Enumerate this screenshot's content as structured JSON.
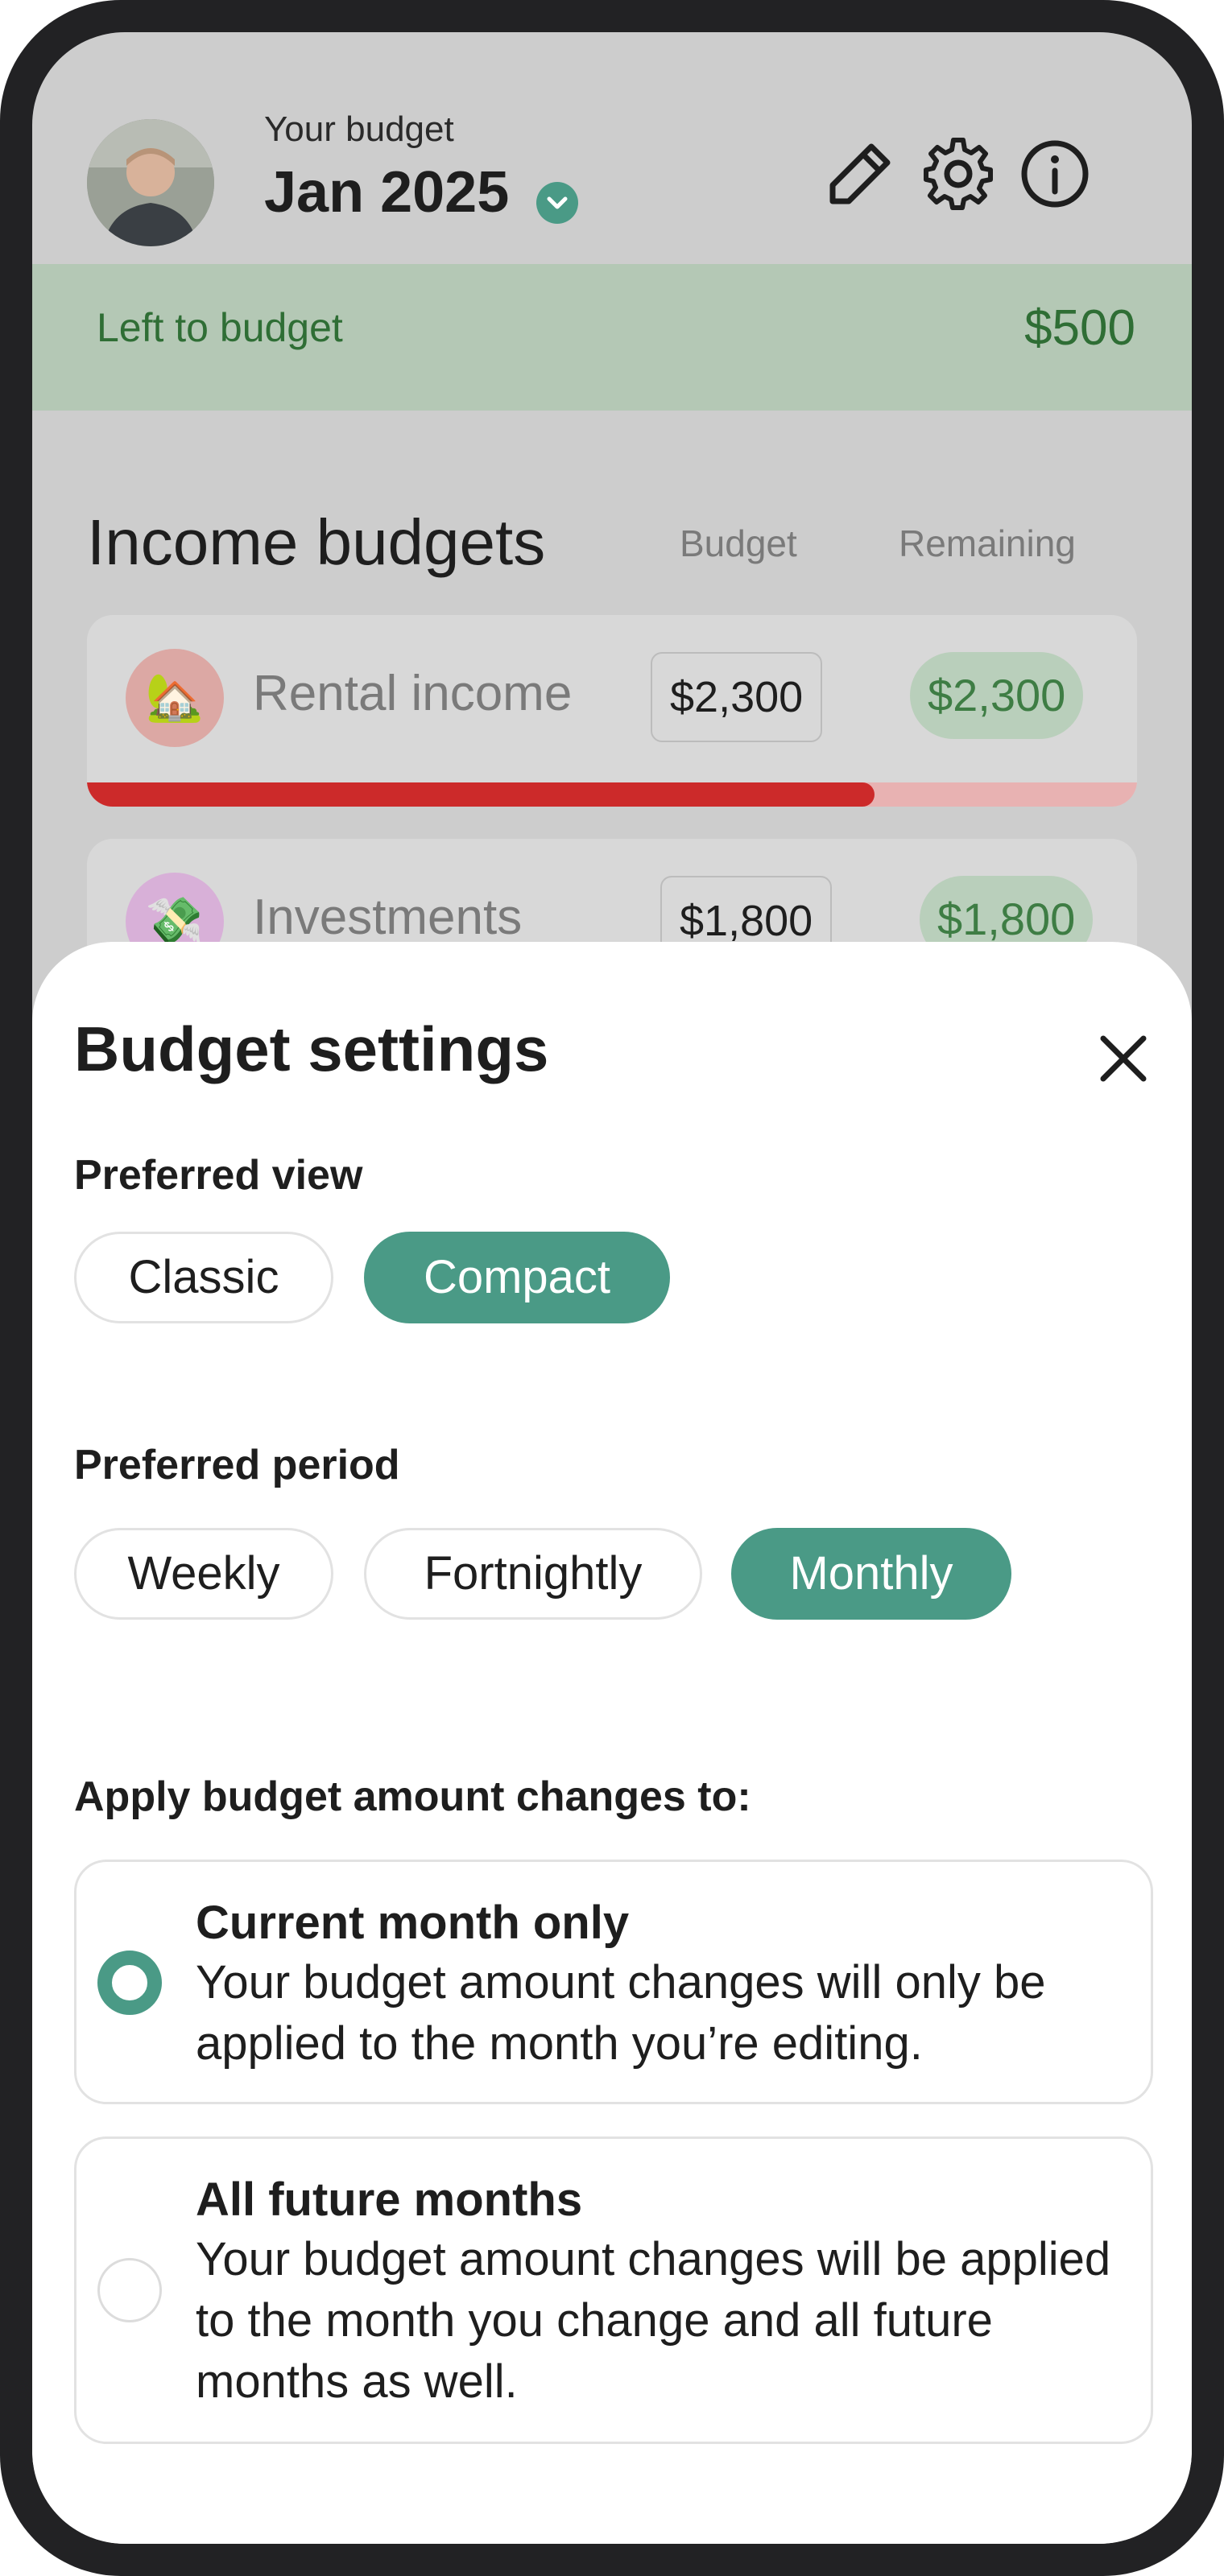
{
  "header": {
    "subtitle": "Your budget",
    "month": "Jan 2025",
    "icons": [
      "pencil-icon",
      "gear-icon",
      "info-icon",
      "chevron-down-icon"
    ]
  },
  "left_to_budget": {
    "label": "Left to budget",
    "value": "$500"
  },
  "income": {
    "title": "Income budgets",
    "col_budget": "Budget",
    "col_remaining": "Remaining",
    "items": [
      {
        "icon": "🏡",
        "name": "Rental income",
        "budget": "$2,300",
        "remaining": "$2,300",
        "progress": 0.75
      },
      {
        "icon": "💸",
        "name": "Investments",
        "budget": "$1,800",
        "remaining": "$1,800"
      }
    ]
  },
  "settings": {
    "title": "Budget settings",
    "view_label": "Preferred view",
    "views": [
      "Classic",
      "Compact"
    ],
    "view_selected": "Compact",
    "period_label": "Preferred period",
    "periods": [
      "Weekly",
      "Fortnightly",
      "Monthly"
    ],
    "period_selected": "Monthly",
    "apply_label": "Apply budget amount changes to:",
    "options": [
      {
        "title": "Current month only",
        "desc": "Your budget amount changes will only be applied to the month you’re editing.",
        "selected": true
      },
      {
        "title": "All future months",
        "desc": "Your budget amount changes will be applied to the month you change and all future months as well.",
        "selected": false
      }
    ]
  },
  "colors": {
    "accent": "#4a9a86",
    "positive_text": "#2f6e35",
    "progress_red": "#cc2a2a"
  }
}
